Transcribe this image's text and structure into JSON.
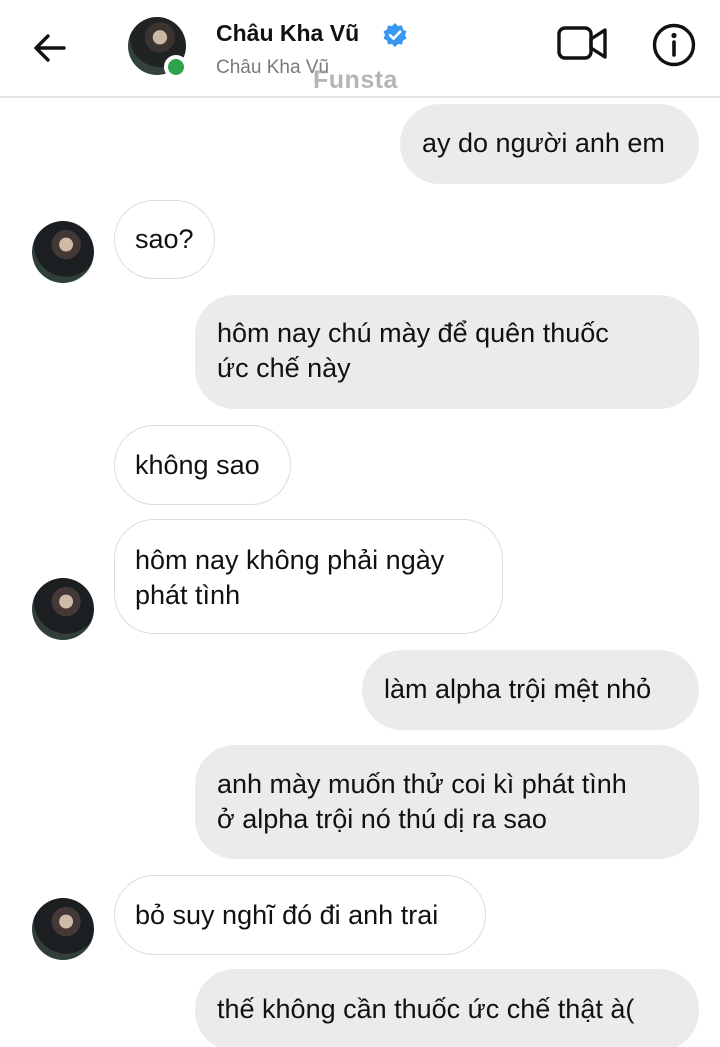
{
  "header": {
    "contact_name": "Châu Kha Vũ",
    "contact_subtitle": "Châu Kha Vũ",
    "watermark": "Funsta",
    "status_color": "#31a24c",
    "verified_color": "#3897f0",
    "icons": [
      "back-arrow-icon",
      "verified-badge-icon",
      "video-call-icon",
      "info-icon"
    ]
  },
  "messages": [
    {
      "sender": "me",
      "lines": [
        "ay do người anh em"
      ]
    },
    {
      "sender": "them",
      "lines": [
        "sao?"
      ]
    },
    {
      "sender": "me",
      "lines": [
        "hôm nay chú mày để quên thuốc",
        "ức chế này"
      ]
    },
    {
      "sender": "them",
      "lines": [
        "không sao"
      ]
    },
    {
      "sender": "them",
      "lines": [
        "hôm nay không phải ngày",
        "phát tình"
      ]
    },
    {
      "sender": "me",
      "lines": [
        "làm alpha trội mệt nhỏ"
      ]
    },
    {
      "sender": "me",
      "lines": [
        "anh mày muốn thử coi kì phát tình",
        "ở alpha trội nó thú dị ra sao"
      ]
    },
    {
      "sender": "them",
      "lines": [
        "bỏ suy nghĩ đó đi anh trai"
      ]
    },
    {
      "sender": "me",
      "lines": [
        "thế không cần thuốc ức chế thật à("
      ]
    }
  ]
}
